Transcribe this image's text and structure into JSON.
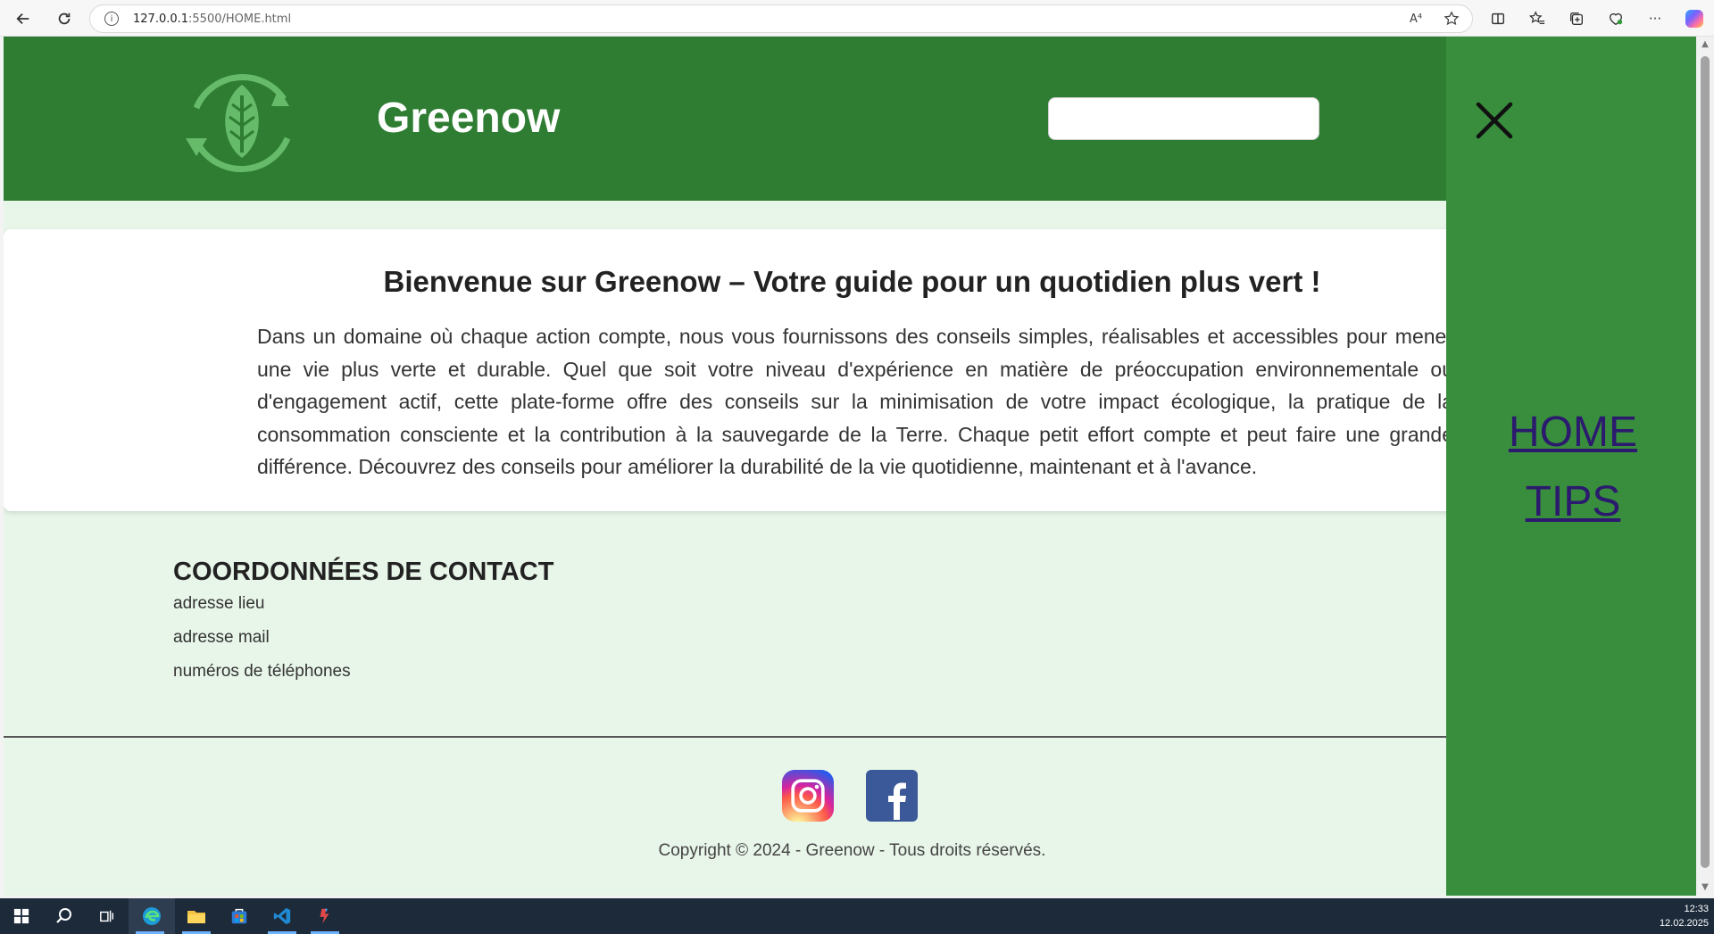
{
  "browser": {
    "url_host": "127.0.0.1",
    "url_path": ":5500/HOME.html",
    "read_aloud_label": "A⁴"
  },
  "site": {
    "title": "Greenow",
    "search_placeholder": ""
  },
  "welcome": {
    "title": "Bienvenue sur Greenow – Votre guide pour un quotidien plus vert !",
    "text": "Dans un domaine où chaque action compte, nous vous fournissons des conseils simples, réalisables et accessibles pour mener une vie plus verte et durable. Quel que soit votre niveau d'expérience en matière de préoccupation environnementale ou d'engagement actif, cette plate-forme offre des conseils sur la minimisation de votre impact écologique, la pratique de la consommation consciente et la contribution à la sauvegarde de la Terre. Chaque petit effort compte et peut faire une grande différence. Découvrez des conseils pour améliorer la durabilité de la vie quotidienne, maintenant et à l'avance."
  },
  "contact": {
    "title": "COORDONNÉES DE CONTACT",
    "lines": [
      "adresse lieu",
      "adresse mail",
      "numéros de téléphones"
    ]
  },
  "footer": {
    "copyright": "Copyright © 2024 - Greenow - Tous droits réservés.",
    "social_icons": [
      "instagram-icon",
      "facebook-icon"
    ]
  },
  "menu": {
    "items": [
      {
        "label": "HOME"
      },
      {
        "label": "TIPS"
      }
    ]
  },
  "taskbar": {
    "time": "12:33",
    "date": "12.02.2025"
  },
  "colors": {
    "header_green": "#2e7d32",
    "menu_green": "#388e3c",
    "page_bg": "#e8f5e9",
    "link_color": "#2b1a6e"
  }
}
